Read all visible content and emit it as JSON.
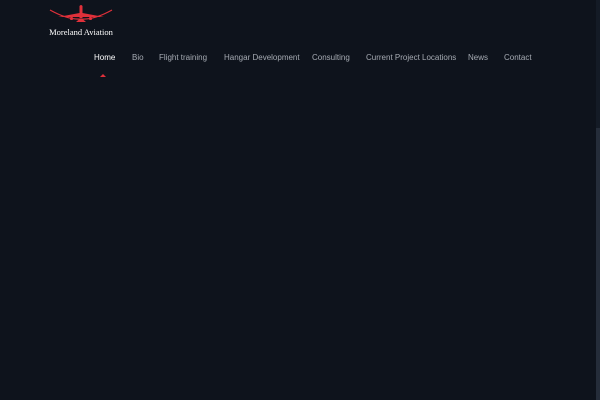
{
  "brand": {
    "name": "Moreland Aviation",
    "logo_icon": "airplane-icon",
    "logo_color": "#e0303a"
  },
  "nav": {
    "items": [
      {
        "label": "Home",
        "active": true
      },
      {
        "label": "Bio"
      },
      {
        "label": "Flight training"
      },
      {
        "label": "Hangar Development"
      },
      {
        "label": "Consulting"
      },
      {
        "label": "Current Project Locations"
      },
      {
        "label": "News"
      },
      {
        "label": "Contact"
      }
    ]
  },
  "colors": {
    "background": "#0e131c",
    "nav_text": "#a6abb3",
    "nav_active": "#ffffff",
    "accent": "#e0303a"
  }
}
